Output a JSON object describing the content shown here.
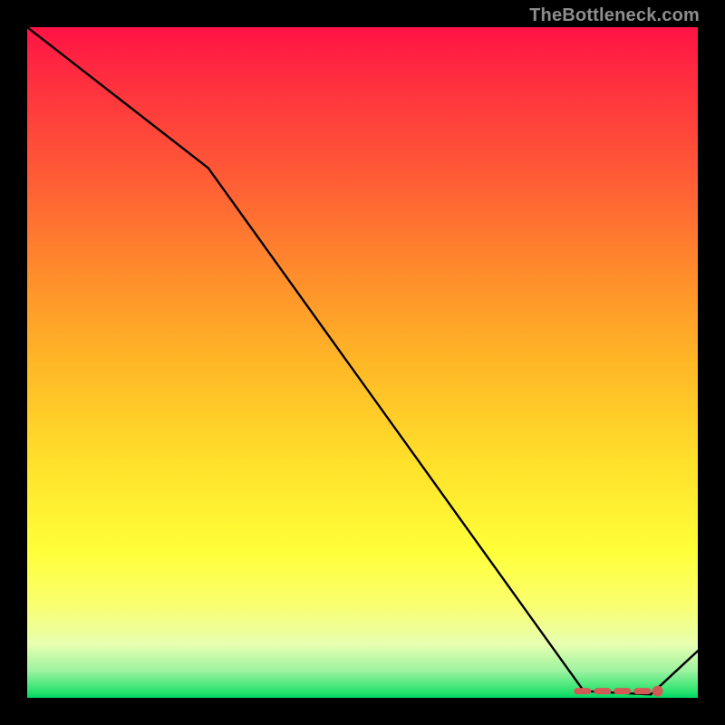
{
  "watermark": "TheBottleneck.com",
  "colors": {
    "line": "#000000",
    "marker": "#d25a56",
    "gradient_top": "#ff1345",
    "gradient_bottom": "#00d864",
    "frame": "#000000"
  },
  "chart_data": {
    "type": "line",
    "title": "",
    "xlabel": "",
    "ylabel": "",
    "xlim": [
      0,
      100
    ],
    "ylim": [
      0,
      100
    ],
    "x": [
      0,
      27,
      83,
      93,
      100
    ],
    "values": [
      100,
      79,
      1,
      0.5,
      7
    ],
    "highlight_segment": {
      "x_from": 82,
      "x_to": 94,
      "y": 1
    },
    "marker": {
      "x": 94,
      "y": 1
    }
  }
}
